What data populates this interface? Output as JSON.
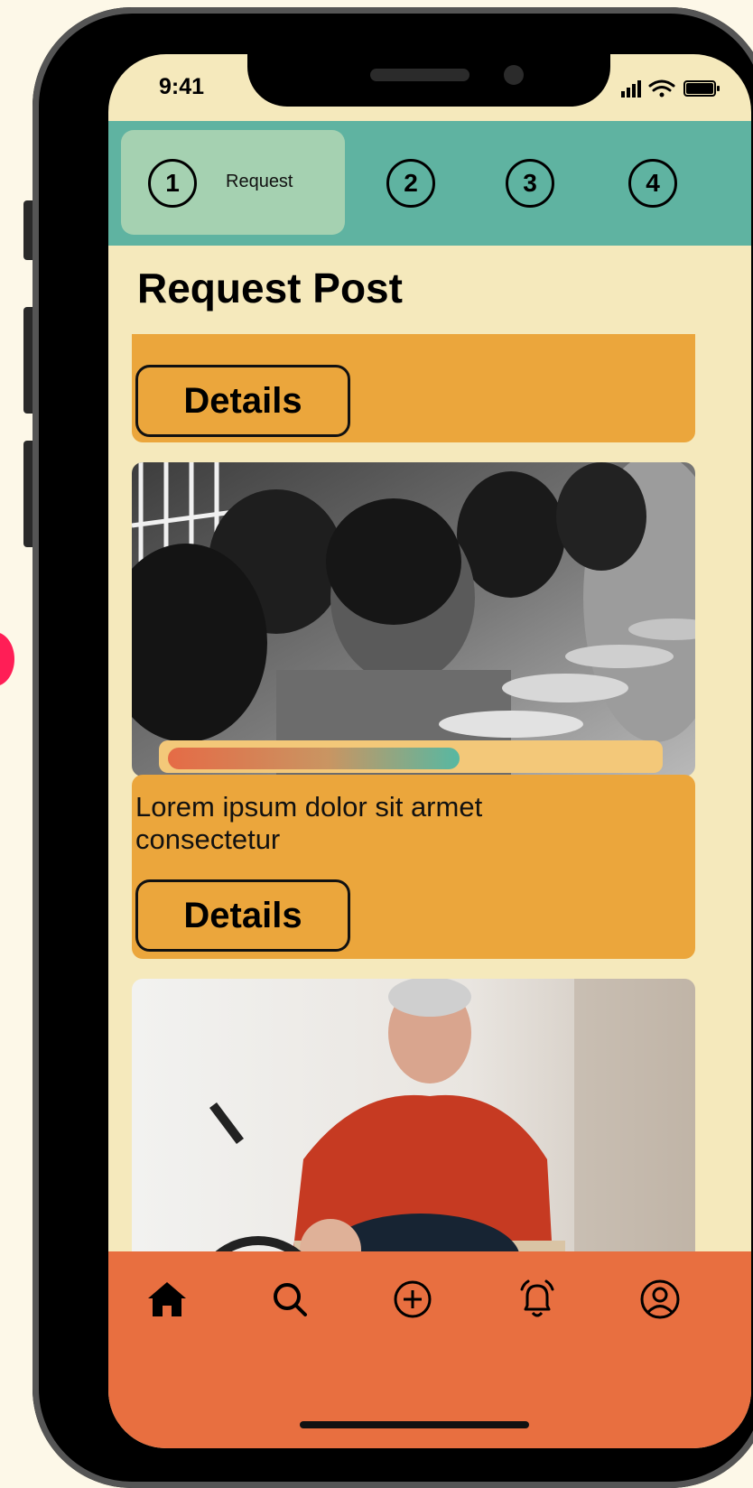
{
  "status_bar": {
    "time": "9:41"
  },
  "stepper": {
    "steps": [
      {
        "number": "1",
        "label": "Request"
      },
      {
        "number": "2"
      },
      {
        "number": "3"
      },
      {
        "number": "4"
      }
    ],
    "active_step": 1
  },
  "page": {
    "title": "Request Post"
  },
  "posts": [
    {
      "text_line2": "consectetur",
      "button_label": "Details"
    },
    {
      "progress": 0.6,
      "text": "Lorem ipsum dolor sit armet consectetur",
      "button_label": "Details"
    },
    {}
  ],
  "nav": {
    "items": [
      {
        "icon": "home-icon",
        "active": true
      },
      {
        "icon": "search-icon"
      },
      {
        "icon": "add-icon"
      },
      {
        "icon": "bell-icon"
      },
      {
        "icon": "profile-icon"
      }
    ]
  },
  "colors": {
    "background": "#fdf8e8",
    "screen": "#f5e9bc",
    "stepper": "#5fb3a1",
    "step_active": "#a5d1b1",
    "card": "#eba63c",
    "nav": "#e86f40",
    "accent_red": "#ff1e56"
  }
}
